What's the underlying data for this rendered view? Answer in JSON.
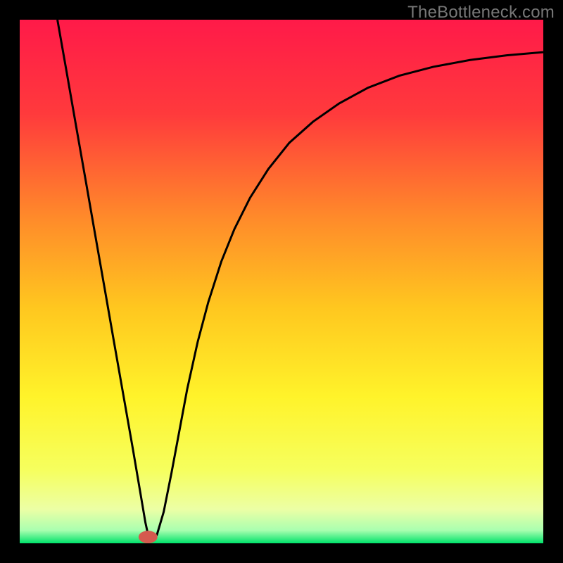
{
  "watermark": "TheBottleneck.com",
  "chart_data": {
    "type": "line",
    "title": "",
    "xlabel": "",
    "ylabel": "",
    "xlim": [
      0,
      1
    ],
    "ylim": [
      0,
      1
    ],
    "background_gradient_stops": [
      {
        "offset": 0.0,
        "color": "#ff1a49"
      },
      {
        "offset": 0.18,
        "color": "#ff3a3c"
      },
      {
        "offset": 0.38,
        "color": "#ff8b2a"
      },
      {
        "offset": 0.55,
        "color": "#ffc71f"
      },
      {
        "offset": 0.72,
        "color": "#fff32a"
      },
      {
        "offset": 0.86,
        "color": "#f6ff5e"
      },
      {
        "offset": 0.935,
        "color": "#ecffa5"
      },
      {
        "offset": 0.975,
        "color": "#aaffb0"
      },
      {
        "offset": 1.0,
        "color": "#00e26a"
      }
    ],
    "marker": {
      "x": 0.245,
      "y": 0.012,
      "color": "#d55a4e",
      "rx": 0.018,
      "ry": 0.012
    },
    "series": [
      {
        "name": "curve",
        "color": "#000000",
        "stroke_width": 3,
        "points": [
          {
            "x": 0.072,
            "y": 1.0
          },
          {
            "x": 0.09,
            "y": 0.898
          },
          {
            "x": 0.108,
            "y": 0.795
          },
          {
            "x": 0.126,
            "y": 0.693
          },
          {
            "x": 0.144,
            "y": 0.59
          },
          {
            "x": 0.162,
            "y": 0.488
          },
          {
            "x": 0.18,
            "y": 0.385
          },
          {
            "x": 0.198,
            "y": 0.283
          },
          {
            "x": 0.216,
            "y": 0.181
          },
          {
            "x": 0.23,
            "y": 0.099
          },
          {
            "x": 0.24,
            "y": 0.04
          },
          {
            "x": 0.247,
            "y": 0.008
          },
          {
            "x": 0.255,
            "y": 0.008
          },
          {
            "x": 0.262,
            "y": 0.016
          },
          {
            "x": 0.275,
            "y": 0.06
          },
          {
            "x": 0.29,
            "y": 0.135
          },
          {
            "x": 0.305,
            "y": 0.215
          },
          {
            "x": 0.32,
            "y": 0.295
          },
          {
            "x": 0.34,
            "y": 0.385
          },
          {
            "x": 0.36,
            "y": 0.46
          },
          {
            "x": 0.385,
            "y": 0.538
          },
          {
            "x": 0.41,
            "y": 0.6
          },
          {
            "x": 0.44,
            "y": 0.66
          },
          {
            "x": 0.475,
            "y": 0.715
          },
          {
            "x": 0.515,
            "y": 0.765
          },
          {
            "x": 0.56,
            "y": 0.805
          },
          {
            "x": 0.61,
            "y": 0.84
          },
          {
            "x": 0.665,
            "y": 0.87
          },
          {
            "x": 0.725,
            "y": 0.893
          },
          {
            "x": 0.79,
            "y": 0.91
          },
          {
            "x": 0.86,
            "y": 0.923
          },
          {
            "x": 0.93,
            "y": 0.932
          },
          {
            "x": 1.0,
            "y": 0.938
          }
        ]
      }
    ]
  }
}
